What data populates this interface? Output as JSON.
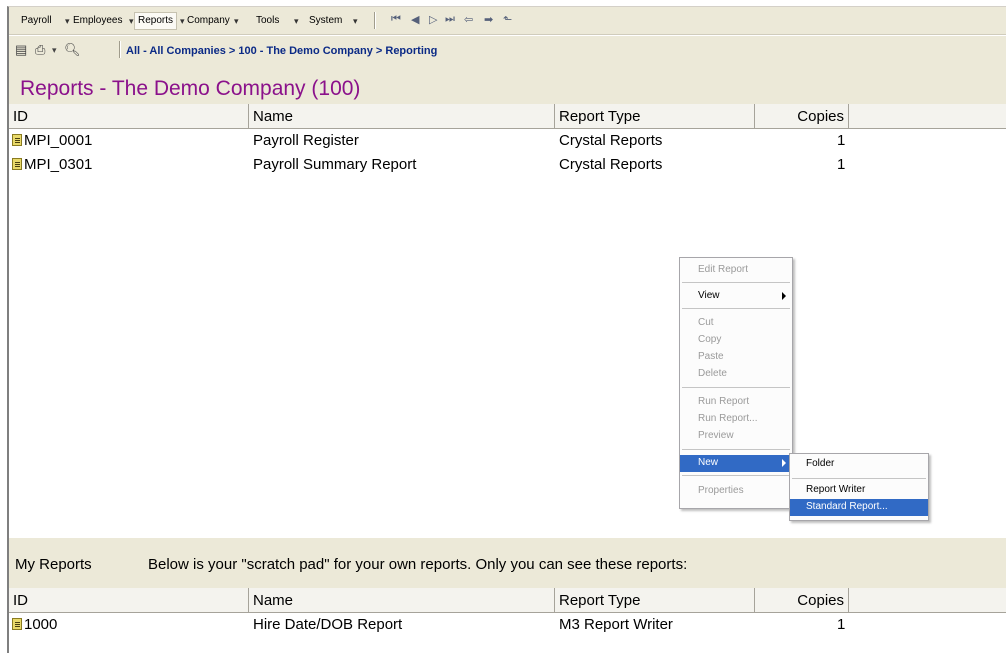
{
  "menubar": {
    "items": [
      "Payroll",
      "Employees",
      "Reports",
      "Company",
      "Tools",
      "System"
    ]
  },
  "toolbar": {
    "breadcrumb": "All - All Companies > 100 - The Demo Company > Reporting"
  },
  "page": {
    "title": "Reports - The Demo Company (100)"
  },
  "columns": [
    "ID",
    "Name",
    "Report Type",
    "Copies"
  ],
  "reports": [
    {
      "id": "MPI_0001",
      "name": "Payroll Register",
      "type": "Crystal Reports",
      "copies": "1"
    },
    {
      "id": "MPI_0301",
      "name": "Payroll Summary Report",
      "type": "Crystal Reports",
      "copies": "1"
    }
  ],
  "my_reports": {
    "label": "My Reports",
    "description": "Below is your \"scratch pad\" for your own reports.  Only you can see these reports:",
    "rows": [
      {
        "id": "1000",
        "name": "Hire Date/DOB Report",
        "type": "M3 Report Writer",
        "copies": "1"
      }
    ]
  },
  "context_menu": {
    "items": [
      "Edit Report",
      "View",
      "Cut",
      "Copy",
      "Paste",
      "Delete",
      "Run Report",
      "Run Report...",
      "Preview",
      "New",
      "Properties"
    ],
    "highlighted": "New"
  },
  "submenu": {
    "items": [
      "Folder",
      "Report Writer",
      "Standard Report..."
    ],
    "highlighted": "Standard Report..."
  },
  "colors": {
    "title": "#8b118b",
    "breadcrumb": "#0b2a86",
    "highlight": "#316ac5"
  }
}
